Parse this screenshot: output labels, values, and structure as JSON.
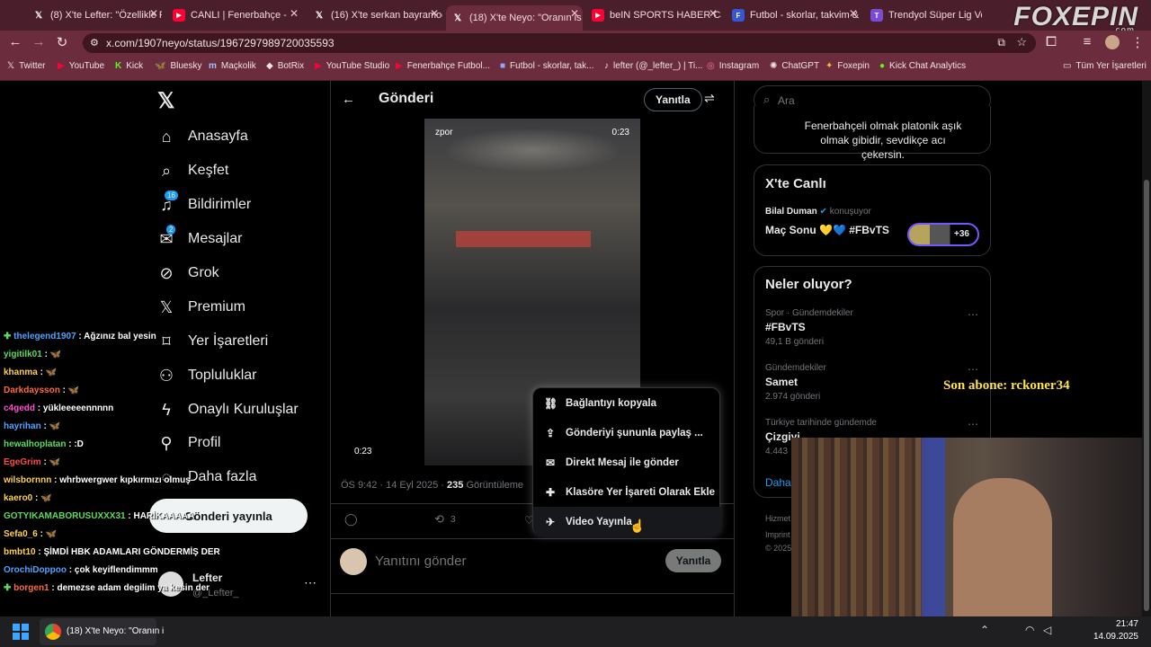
{
  "browser": {
    "tabs": [
      {
        "label": "(8) X'te Lefter: \"Özellikle F",
        "icon": "x-icon",
        "close": "✕"
      },
      {
        "label": "CANLI | Fenerbahçe -",
        "icon": "youtube-icon",
        "close": "✕"
      },
      {
        "label": "(16) X'te serkan bayramog",
        "icon": "x-icon",
        "close": "✕"
      },
      {
        "label": "(18) X'te Neyo: \"Oranın is",
        "icon": "x-icon",
        "close": "✕"
      },
      {
        "label": "beIN SPORTS HABER Can",
        "icon": "youtube-icon",
        "close": "✕"
      },
      {
        "label": "Futbol - skorlar, takvim &",
        "icon": "futbol-icon",
        "close": "✕"
      },
      {
        "label": "Trendyol Süper Lig Ve",
        "icon": "trendyol-icon",
        "close": "✕"
      }
    ],
    "url": "x.com/1907neyo/status/1967297989720035593",
    "watermark": "FOXEPIN",
    "watermark_sub": ".com",
    "bookmarks": [
      "Twitter",
      "YouTube",
      "Kick",
      "Bluesky",
      "Maçkolik",
      "BotRix",
      "YouTube Studio",
      "Fenerbahçe Futbol...",
      "Futbol - skorlar, tak...",
      "lefter (@_lefter_) | Ti...",
      "Instagram",
      "ChatGPT",
      "Foxepin",
      "Kick Chat Analytics"
    ],
    "all_bookmarks": "Tüm Yer İşaretleri"
  },
  "sidebar": {
    "items": [
      {
        "label": "Anasayfa",
        "icon": "home-icon"
      },
      {
        "label": "Keşfet",
        "icon": "search-icon"
      },
      {
        "label": "Bildirimler",
        "icon": "bell-icon",
        "badge": "16"
      },
      {
        "label": "Mesajlar",
        "icon": "mail-icon",
        "badge": "2"
      },
      {
        "label": "Grok",
        "icon": "grok-icon"
      },
      {
        "label": "Premium",
        "icon": "x-icon"
      },
      {
        "label": "Yer İşaretleri",
        "icon": "bookmark-icon"
      },
      {
        "label": "Topluluklar",
        "icon": "communities-icon"
      },
      {
        "label": "Onaylı Kuruluşlar",
        "icon": "lightning-icon"
      },
      {
        "label": "Profil",
        "icon": "profile-icon"
      },
      {
        "label": "Daha fazla",
        "icon": "more-icon"
      }
    ],
    "post_button": "Gönderi yayınla",
    "account": {
      "name": "Lefter",
      "handle": "@_Lefter_"
    }
  },
  "post": {
    "header_title": "Gönderi",
    "reply_button": "Yanıtla",
    "video_source": "zpor",
    "video_time_top": "0:23",
    "video_time_bottom": "0:23",
    "timestamp": "ÖS 9:42 · 14 Eyl 2025 ·",
    "views_count": "235",
    "views_label": "Görüntüleme",
    "retweets": "3",
    "reply_placeholder": "Yanıtını gönder",
    "reply_submit": "Yanıtla"
  },
  "menu": {
    "items": [
      {
        "label": "Bağlantıyı kopyala",
        "icon": "link-icon"
      },
      {
        "label": "Gönderiyi şununla paylaş ...",
        "icon": "share-icon"
      },
      {
        "label": "Direkt Mesaj ile gönder",
        "icon": "mail-icon"
      },
      {
        "label": "Klasöre Yer İşareti Olarak Ekle",
        "icon": "bookmark-add-icon"
      },
      {
        "label": "Video Yayınla",
        "icon": "broadcast-icon"
      }
    ]
  },
  "right": {
    "search_placeholder": "Ara",
    "bio": "Fenerbahçeli olmak platonik aşık olmak gibidir, sevdikçe acı çekersin.",
    "live": {
      "title": "X'te Canlı",
      "host": "Bilal Duman",
      "host_suffix": "konuşuyor",
      "topic": "Maç Sonu 💛💙 #FBvTS",
      "listeners": "+36"
    },
    "trends_title": "Neler oluyor?",
    "trends": [
      {
        "meta": "Spor · Gündemdekiler",
        "title": "#FBvTS",
        "count": "49,1 B gönderi"
      },
      {
        "meta": "Gündemdekiler",
        "title": "Samet",
        "count": "2.974 gönderi"
      },
      {
        "meta": "Türkiye tarihinde gündemde",
        "title": "Çizgiyi",
        "count": "4.443"
      }
    ],
    "show_more": "Daha",
    "footer": [
      "Hizmet",
      "Imprint",
      "© 2025"
    ],
    "more_dots": "⋯"
  },
  "stream": {
    "son_abone": "Son abone: rckoner34",
    "chat": [
      {
        "user": "thelegend1907",
        "msg": "Ağzınız bal yesin",
        "color": "#4fa3ff",
        "badge": true
      },
      {
        "user": "yigitilk01",
        "msg": "🦋",
        "color": "#5ddb5d"
      },
      {
        "user": "khanma",
        "msg": "🦋",
        "color": "#ffd24a"
      },
      {
        "user": "Darkdaysson",
        "msg": "🦋",
        "color": "#ff6a3d"
      },
      {
        "user": "c4gedd",
        "msg": "yükleeeeennnnn",
        "color": "#ff4fd2"
      },
      {
        "user": "hayrihan",
        "msg": "🦋",
        "color": "#4fa3ff"
      },
      {
        "user": "hewalhoplatan",
        "msg": ":D",
        "color": "#5ddb5d"
      },
      {
        "user": "EgeGrim",
        "msg": "🦋",
        "color": "#ff4a4a"
      },
      {
        "user": "wilsbornnn",
        "msg": "whrbwergwer kıpkırmızı olmuş",
        "color": "#ffd24a"
      },
      {
        "user": "kaero0",
        "msg": "🦋",
        "color": "#ffd24a"
      },
      {
        "user": "GOTYIKAMABORUSUXXX31",
        "msg": "HARİKAAAAA",
        "color": "#5ddb5d"
      },
      {
        "user": "Sefa0_6",
        "msg": "🦋",
        "color": "#ffd24a"
      },
      {
        "user": "bmbt10",
        "msg": "ŞİMDİ HBK ADAMLARI GÖNDERMİŞ DER",
        "color": "#ffd24a"
      },
      {
        "user": "OrochiDoppoo",
        "msg": "çok keyiflendimmm",
        "color": "#4fa3ff"
      },
      {
        "user": "borgen1",
        "msg": "demezse adam degilim ya kesin der",
        "color": "#ff6a3d",
        "badge": true
      }
    ]
  },
  "taskbar": {
    "app_label": "(18) X'te Neyo: \"Oranın i",
    "time": "21:47",
    "date": "14.09.2025"
  }
}
